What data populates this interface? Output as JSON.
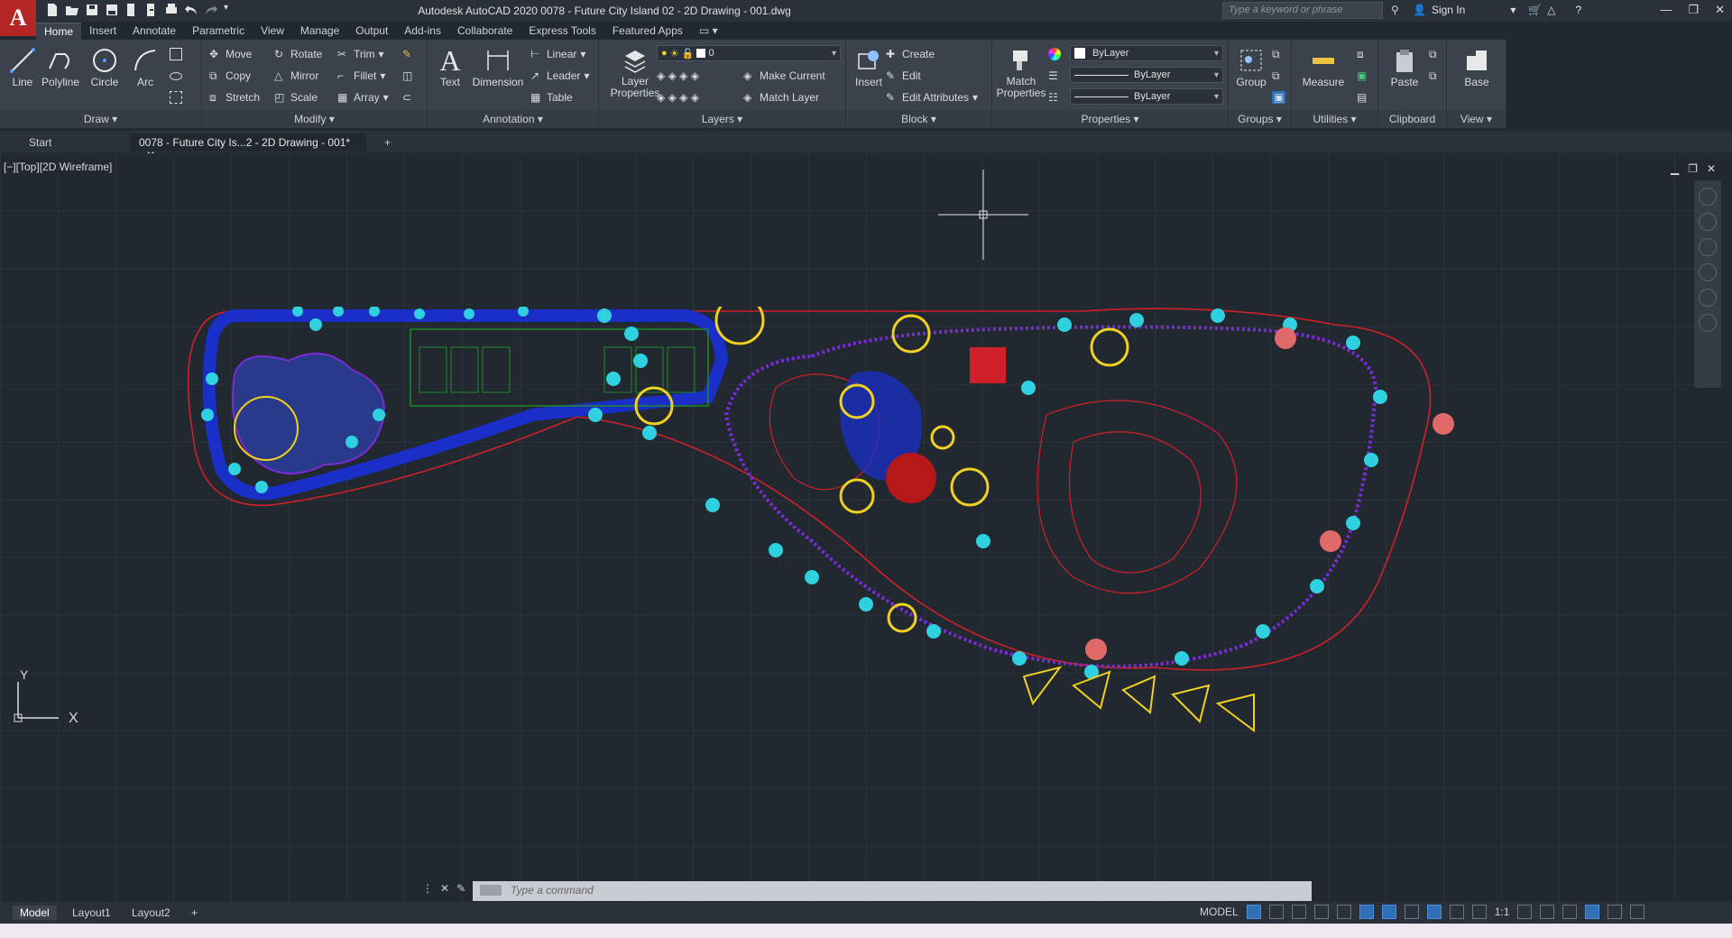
{
  "app": {
    "title": "Autodesk AutoCAD 2020    0078 - Future City Island 02 - 2D Drawing - 001.dwg",
    "search_placeholder": "Type a keyword or phrase",
    "sign_in": "Sign In"
  },
  "ribbon_tabs": [
    "Home",
    "Insert",
    "Annotate",
    "Parametric",
    "View",
    "Manage",
    "Output",
    "Add-ins",
    "Collaborate",
    "Express Tools",
    "Featured Apps"
  ],
  "panels": {
    "draw": {
      "title": "Draw ▾",
      "line": "Line",
      "polyline": "Polyline",
      "circle": "Circle",
      "arc": "Arc"
    },
    "modify": {
      "title": "Modify ▾",
      "move": "Move",
      "rotate": "Rotate",
      "trim": "Trim",
      "copy": "Copy",
      "mirror": "Mirror",
      "fillet": "Fillet",
      "stretch": "Stretch",
      "scale": "Scale",
      "array": "Array"
    },
    "annotation": {
      "title": "Annotation ▾",
      "text": "Text",
      "dimension": "Dimension",
      "linear": "Linear",
      "leader": "Leader",
      "table": "Table"
    },
    "layers": {
      "title": "Layers ▾",
      "layer_properties": "Layer Properties",
      "current_layer": "0",
      "make_current": "Make Current",
      "match_layer": "Match Layer"
    },
    "block": {
      "title": "Block ▾",
      "insert": "Insert",
      "create": "Create",
      "edit": "Edit",
      "edit_attributes": "Edit Attributes"
    },
    "properties": {
      "title": "Properties ▾",
      "match_properties": "Match Properties",
      "color": "ByLayer",
      "linetype": "ByLayer",
      "lineweight": "ByLayer"
    },
    "groups": {
      "title": "Groups ▾",
      "group": "Group"
    },
    "utilities": {
      "title": "Utilities ▾",
      "measure": "Measure"
    },
    "clipboard": {
      "title": "Clipboard",
      "paste": "Paste"
    },
    "view": {
      "title": "View ▾",
      "base": "Base"
    }
  },
  "file_tabs": {
    "start": "Start",
    "active": "0078 - Future City Is...2 - 2D Drawing - 001*"
  },
  "viewport": {
    "label": "[−][Top][2D Wireframe]",
    "axis_x": "X",
    "axis_y": "Y"
  },
  "command": {
    "placeholder": "Type  a  command"
  },
  "layouts": [
    "Model",
    "Layout1",
    "Layout2"
  ],
  "status": {
    "space": "MODEL",
    "scale": "1:1"
  },
  "colors": {
    "boundary": "#d0202a",
    "pond": "#1a2fc8",
    "trees": "#2fd0e0",
    "shrubs": "#f0d020",
    "path": "#7a2bd8",
    "lawn": "#1f8a2a"
  }
}
